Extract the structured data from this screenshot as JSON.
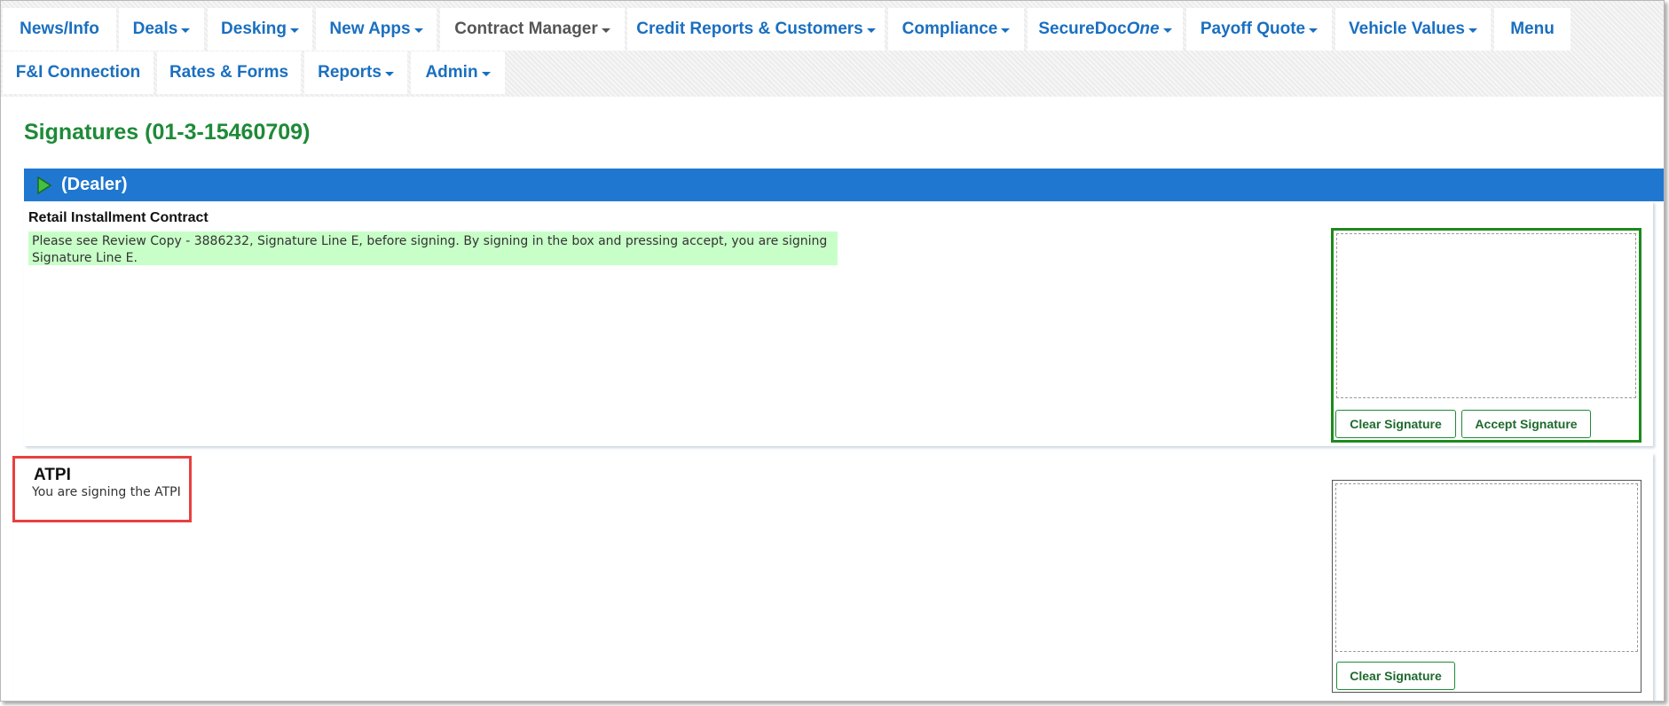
{
  "nav": {
    "row1": [
      {
        "label": "News/Info",
        "dropdown": false
      },
      {
        "label": "Deals",
        "dropdown": true
      },
      {
        "label": "Desking",
        "dropdown": true
      },
      {
        "label": "New Apps",
        "dropdown": true
      },
      {
        "label": "Contract Manager",
        "dropdown": true,
        "active": true
      },
      {
        "label": "Credit Reports & Customers",
        "dropdown": true
      },
      {
        "label": "Compliance",
        "dropdown": true
      },
      {
        "label": "SecureDoc",
        "label_italic": "One",
        "dropdown": true
      },
      {
        "label": "Payoff Quote",
        "dropdown": true
      },
      {
        "label": "Vehicle Values",
        "dropdown": true
      },
      {
        "label": "Menu",
        "dropdown": false
      }
    ],
    "row2": [
      {
        "label": "F&I Connection",
        "dropdown": false
      },
      {
        "label": "Rates & Forms",
        "dropdown": false
      },
      {
        "label": "Reports",
        "dropdown": true
      },
      {
        "label": "Admin",
        "dropdown": true
      }
    ]
  },
  "page": {
    "title": "Signatures (01-3-15460709)"
  },
  "section": {
    "title": "(Dealer)",
    "icon": "play-icon"
  },
  "documents": [
    {
      "name": "Retail Installment Contract",
      "notice": "Please see Review Copy - 3886232, Signature Line E, before signing. By signing in the box and pressing accept, you are signing Signature Line E.",
      "clear_label": "Clear Signature",
      "accept_label": "Accept Signature"
    },
    {
      "name": "ATPI",
      "description": "You are signing the ATPI",
      "clear_label": "Clear Signature"
    }
  ],
  "colors": {
    "nav_link": "#1a6fc0",
    "nav_active": "#555555",
    "title_green": "#1e8a37",
    "section_blue": "#1f77d0",
    "notice_bg": "#c8ffc8",
    "highlight_red": "#e84040"
  }
}
